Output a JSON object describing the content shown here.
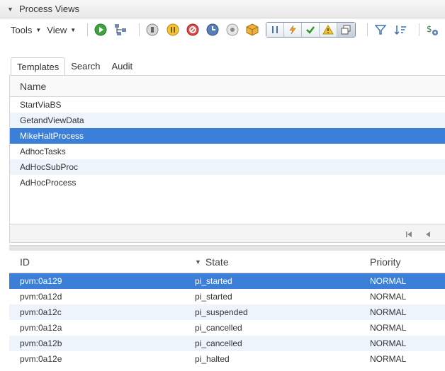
{
  "panel": {
    "title": "Process Views",
    "toggle": "▼"
  },
  "toolbar": {
    "tools_label": "Tools",
    "view_label": "View",
    "caret": "▼"
  },
  "tabs": [
    {
      "label": "Templates",
      "active": true
    },
    {
      "label": "Search",
      "active": false
    },
    {
      "label": "Audit",
      "active": false
    }
  ],
  "templates": {
    "column_header": "Name",
    "rows": [
      {
        "name": "StartViaBS"
      },
      {
        "name": "GetandViewData"
      },
      {
        "name": "MikeHaltProcess",
        "selected": true
      },
      {
        "name": "AdhocTasks"
      },
      {
        "name": "AdHocSubProc"
      },
      {
        "name": "AdHocProcess"
      }
    ]
  },
  "instances": {
    "headers": {
      "id": "ID",
      "state": "State",
      "priority": "Priority",
      "sort_icon": "▼"
    },
    "rows": [
      {
        "id": "pvm:0a129",
        "state": "pi_started",
        "priority": "NORMAL",
        "selected": true
      },
      {
        "id": "pvm:0a12d",
        "state": "pi_started",
        "priority": "NORMAL"
      },
      {
        "id": "pvm:0a12c",
        "state": "pi_suspended",
        "priority": "NORMAL"
      },
      {
        "id": "pvm:0a12a",
        "state": "pi_cancelled",
        "priority": "NORMAL"
      },
      {
        "id": "pvm:0a12b",
        "state": "pi_cancelled",
        "priority": "NORMAL"
      },
      {
        "id": "pvm:0a12e",
        "state": "pi_halted",
        "priority": "NORMAL"
      }
    ]
  },
  "colors": {
    "selection": "#3b7fd8",
    "alt_row": "#eef4fb"
  }
}
